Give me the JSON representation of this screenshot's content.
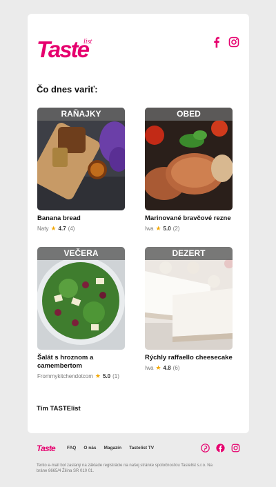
{
  "brand": {
    "name": "Taste",
    "suffix": "list",
    "color": "#e6006e"
  },
  "header": {
    "social_icons": [
      "facebook-icon",
      "instagram-icon"
    ]
  },
  "heading": "Čo dnes variť:",
  "recipes": [
    {
      "category": "RAŇAJKY",
      "name": "Banana bread",
      "author": "Naty",
      "rating": "4.7",
      "reviews": "(4)"
    },
    {
      "category": "OBED",
      "name": "Marinované bravčové rezne",
      "author": "Iwa",
      "rating": "5.0",
      "reviews": "(2)"
    },
    {
      "category": "VEČERA",
      "name": "Šalát s hroznom a camembertom",
      "author": "Frommykitchendotcom",
      "rating": "5.0",
      "reviews": "(1)"
    },
    {
      "category": "DEZERT",
      "name": "Rýchly raffaello cheesecake",
      "author": "Iwa",
      "rating": "4.8",
      "reviews": "(6)"
    }
  ],
  "signoff": "Tím TASTElist",
  "footer": {
    "links": [
      "FAQ",
      "O nás",
      "Magazín",
      "Tastelist TV"
    ],
    "social_icons": [
      "pinterest-icon",
      "facebook-icon",
      "instagram-icon"
    ],
    "legal": "Tento e-mail bol zaslaný na základe registrácie na našej stránke spoločnosťou Tastelist s.r.o. Na bráne 8665/4 Žilina SR 010 01."
  }
}
